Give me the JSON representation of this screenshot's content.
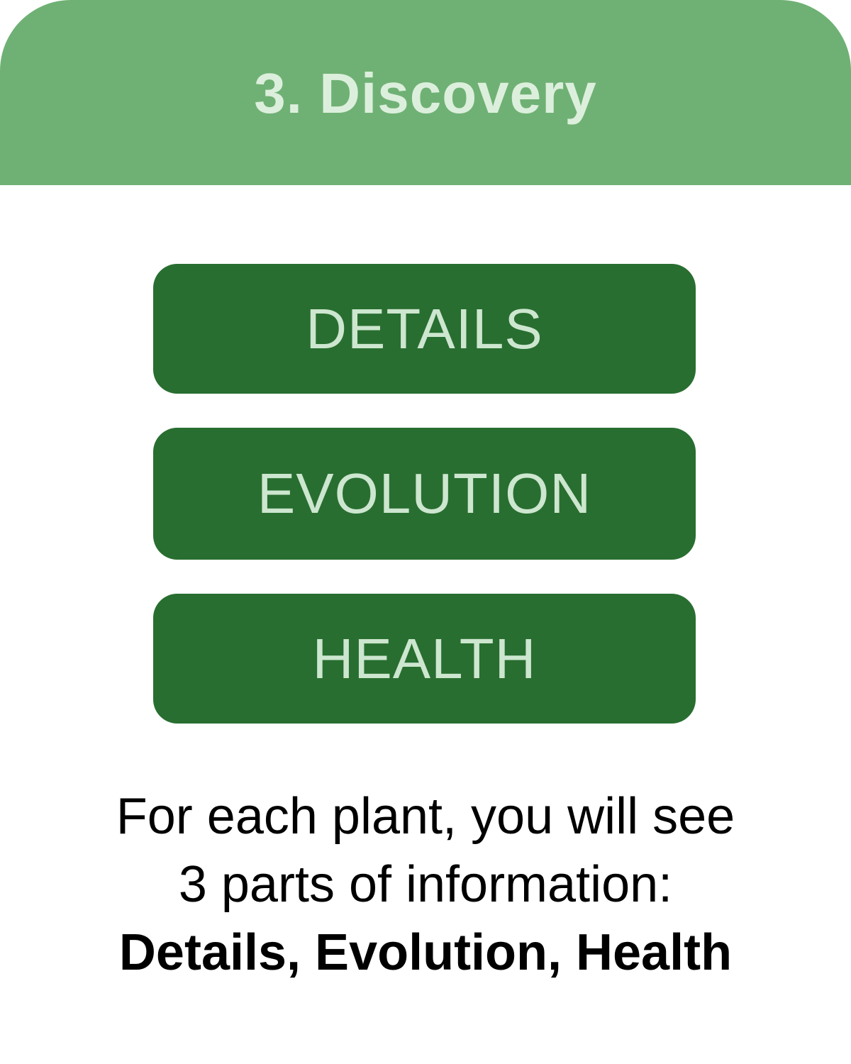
{
  "header": {
    "title": "3. Discovery",
    "background_color": "#6fb174"
  },
  "buttons": [
    {
      "label": "DETAILS"
    },
    {
      "label": "EVOLUTION"
    },
    {
      "label": "HEALTH"
    }
  ],
  "button_color": "#286e30",
  "description": {
    "line1": "For each plant, you will see",
    "line2": "3 parts of information:",
    "line3": "Details, Evolution, Health"
  }
}
